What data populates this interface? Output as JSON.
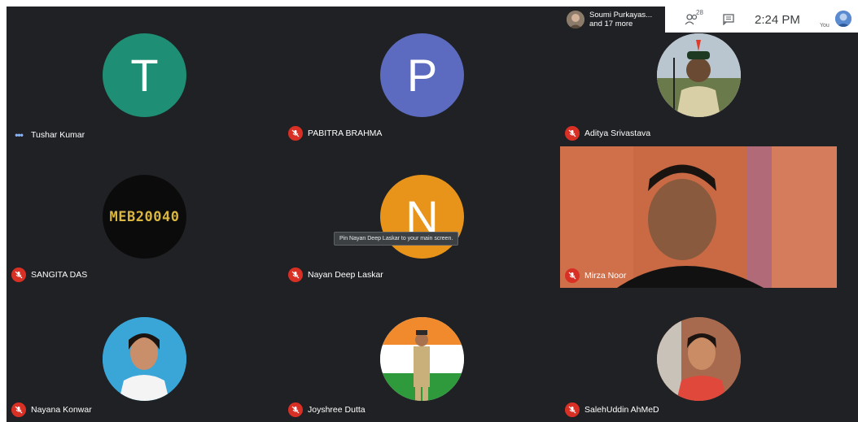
{
  "participants_popup": {
    "line1": "Soumi Purkayas...",
    "line2": "and 17 more"
  },
  "topbar": {
    "participant_count": "28",
    "time": "2:24 PM",
    "self_label": "You"
  },
  "tooltip": "Pin Nayan Deep Laskar to your main screen.",
  "tiles": [
    {
      "name": "Tushar Kumar",
      "letter": "T",
      "avatar_color": "#1e8e74",
      "status": "speaking"
    },
    {
      "name": "PABITRA BRAHMA",
      "letter": "P",
      "avatar_color": "#5c6bc0",
      "status": "muted"
    },
    {
      "name": "Aditya Srivastava",
      "letter": "",
      "avatar_color": "#7a8a5c",
      "status": "muted"
    },
    {
      "name": "SANGITA DAS",
      "code": "MEB20040",
      "avatar_color": "#0b0b0b",
      "status": "muted"
    },
    {
      "name": "Nayan Deep Laskar",
      "letter": "N",
      "avatar_color": "#e8941a",
      "status": "muted"
    },
    {
      "name": "Mirza Noor",
      "letter": "",
      "avatar_color": "#c9623a",
      "status": "muted"
    },
    {
      "name": "Nayana Konwar",
      "letter": "",
      "avatar_color": "#37a7d6",
      "status": "muted"
    },
    {
      "name": "Joyshree Dutta",
      "letter": "",
      "avatar_color": "#e07b2e",
      "status": "muted"
    },
    {
      "name": "SalehUddin AhMeD",
      "letter": "",
      "avatar_color": "#b06a4a",
      "status": "muted"
    }
  ]
}
